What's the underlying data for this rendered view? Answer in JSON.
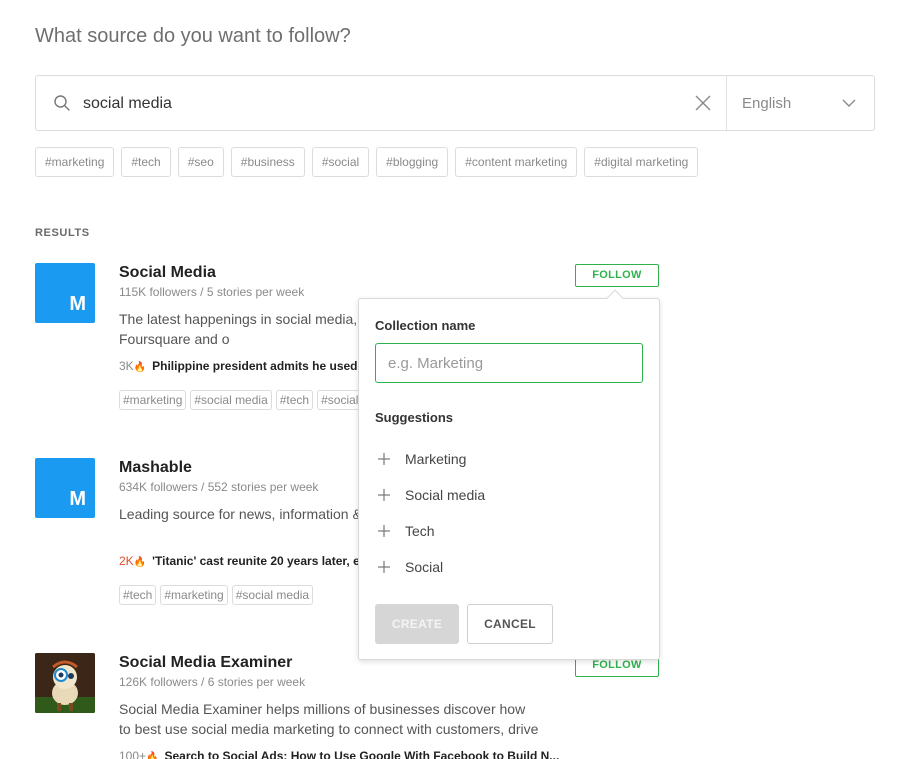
{
  "page": {
    "heading": "What source do you want to follow?"
  },
  "search": {
    "value": "social media",
    "language": "English"
  },
  "tags": [
    "#marketing",
    "#tech",
    "#seo",
    "#business",
    "#social",
    "#blogging",
    "#content marketing",
    "#digital marketing"
  ],
  "results_label": "RESULTS",
  "results": [
    {
      "title": "Social Media",
      "avatar_letter": "M",
      "meta": "115K followers / 5 stories per week",
      "desc": "The latest happenings in social media, Facebook, YouTube, Foursquare and o",
      "story_count": "3K",
      "story_title": "Philippine president admits he used",
      "tags": [
        "#marketing",
        "#social media",
        "#tech",
        "#social"
      ],
      "follow_label": "FOLLOW"
    },
    {
      "title": "Mashable",
      "avatar_letter": "M",
      "meta": "634K followers / 552 stories per week",
      "desc": "Leading source for news, information & Connected Generation.",
      "story_count": "2K",
      "story_title": "'Titanic' cast reunite 20 years later, e",
      "tags": [
        "#tech",
        "#marketing",
        "#social media"
      ]
    },
    {
      "title": "Social Media Examiner",
      "meta": "126K followers / 6 stories per week",
      "desc": "Social Media Examiner helps millions of businesses discover how to best use social media marketing to connect with customers, drive",
      "story_count": "100+",
      "story_title": "Search to Social Ads: How to Use Google With Facebook to Build N...",
      "follow_label": "FOLLOW"
    }
  ],
  "popover": {
    "collection_label": "Collection name",
    "collection_placeholder": "e.g. Marketing",
    "suggestions_label": "Suggestions",
    "suggestions": [
      "Marketing",
      "Social media",
      "Tech",
      "Social"
    ],
    "create_label": "CREATE",
    "cancel_label": "CANCEL"
  },
  "colors": {
    "accent": "#2fb24c",
    "avatar": "#1a9af0",
    "hot": "#e04e2a"
  }
}
